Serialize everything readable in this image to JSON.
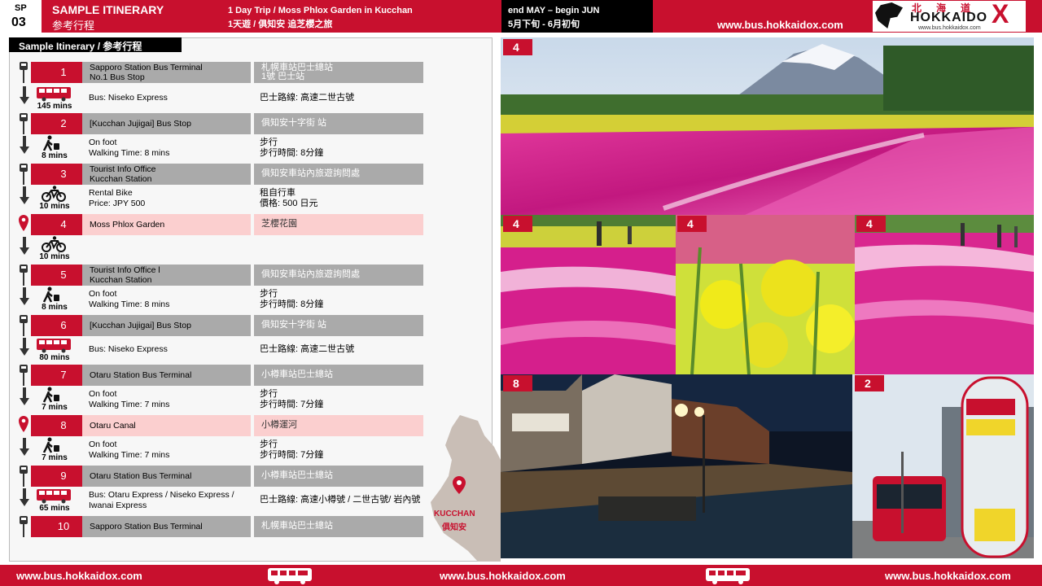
{
  "header": {
    "sp_label": "SP",
    "sp_number": "03",
    "title_en": "SAMPLE ITINERARY",
    "title_zh": "参考行程",
    "trip_en": "1 Day Trip / Moss Phlox Garden in Kucchan",
    "trip_zh": "1天遊 / 俱知安 追芝櫻之旅",
    "season_en": "end MAY – begin JUN",
    "season_zh": "5月下旬 - 6月初旬",
    "url": "www.bus.hokkaidox.com",
    "logo_kanji": "北海道",
    "logo_name": "HOKKAIDO",
    "logo_x": "X",
    "logo_url": "www.bus.hokkaidox.com"
  },
  "panel_title": "Sample Itinerary / 参考行程",
  "stops": [
    {
      "num": "1",
      "en": "Sapporo Station Bus Terminal\nNo.1 Bus Stop",
      "zh": "札幌車站巴士總站\n1號 巴士站",
      "type": "bus_stop",
      "highlight": false
    },
    {
      "num": "2",
      "en": "[Kucchan Jujigai] Bus Stop",
      "zh": "俱知安十字街 站",
      "type": "bus_stop",
      "highlight": false
    },
    {
      "num": "3",
      "en": "Tourist Info Office\nKucchan Station",
      "zh": "俱知安車站內旅遊詢問處",
      "type": "bus_stop",
      "highlight": false
    },
    {
      "num": "4",
      "en": "Moss Phlox Garden",
      "zh": "芝櫻花園",
      "type": "pin",
      "highlight": true
    },
    {
      "num": "5",
      "en": "Tourist Info Office l\nKucchan Station",
      "zh": "俱知安車站內旅遊詢問處",
      "type": "bus_stop",
      "highlight": false
    },
    {
      "num": "6",
      "en": "[Kucchan Jujigai] Bus Stop",
      "zh": "俱知安十字街 站",
      "type": "bus_stop",
      "highlight": false
    },
    {
      "num": "7",
      "en": "Otaru Station Bus Terminal",
      "zh": "小樽車站巴士總站",
      "type": "bus_stop",
      "highlight": false
    },
    {
      "num": "8",
      "en": "Otaru Canal",
      "zh": "小樽運河",
      "type": "pin",
      "highlight": true
    },
    {
      "num": "9",
      "en": "Otaru Station Bus Terminal",
      "zh": "小樽車站巴士總站",
      "type": "bus_stop",
      "highlight": false
    },
    {
      "num": "10",
      "en": "Sapporo Station Bus Terminal",
      "zh": "札幌車站巴士總站",
      "type": "bus_stop",
      "highlight": false
    }
  ],
  "transits": [
    {
      "mode": "bus",
      "mins": "145 mins",
      "en": "Bus: Niseko Express",
      "zh": "巴士路線: 高速二世古號"
    },
    {
      "mode": "walk",
      "mins": "8 mins",
      "en": "On foot\nWalking Time:  8 mins",
      "zh": "步行\n步行時間: 8分鐘"
    },
    {
      "mode": "bike",
      "mins": "10 mins",
      "en": "Rental Bike\nPrice: JPY  500",
      "zh": "租自行車\n價格: 500 日元"
    },
    {
      "mode": "bike",
      "mins": "10 mins",
      "en": "",
      "zh": ""
    },
    {
      "mode": "walk",
      "mins": "8 mins",
      "en": "On foot\nWalking Time:  8 mins",
      "zh": "步行\n步行時間: 8分鐘"
    },
    {
      "mode": "bus",
      "mins": "80 mins",
      "en": "Bus: Niseko Express",
      "zh": "巴士路線: 高速二世古號"
    },
    {
      "mode": "walk",
      "mins": "7 mins",
      "en": "On foot\nWalking Time:  7 mins",
      "zh": "步行\n步行時間: 7分鐘"
    },
    {
      "mode": "walk",
      "mins": "7 mins",
      "en": "On foot\nWalking Time:  7 mins",
      "zh": "步行\n步行時間: 7分鐘"
    },
    {
      "mode": "bus",
      "mins": "65 mins",
      "en": "Bus: Otaru Express / Niseko Express /\n        Iwanai Express",
      "zh": "巴士路線: 高速小樽號 / 二世古號/ 岩內號"
    }
  ],
  "map": {
    "label_en": "KUCCHAN",
    "label_zh": "俱知安"
  },
  "photos": [
    {
      "tag": "4",
      "subject": "moss-phlox-field-mountain"
    },
    {
      "tag": "4",
      "subject": "moss-phlox-field-people"
    },
    {
      "tag": "4",
      "subject": "rapeseed-flowers"
    },
    {
      "tag": "4",
      "subject": "moss-phlox-hill"
    },
    {
      "tag": "8",
      "subject": "otaru-canal-night"
    },
    {
      "tag": "2",
      "subject": "kucchan-jujigai-bus-stop"
    }
  ],
  "footer": {
    "url1": "www.bus.hokkaidox.com",
    "url2": "www.bus.hokkaidox.com",
    "url3": "www.bus.hokkaidox.com"
  },
  "colors": {
    "brand_red": "#c8102e",
    "bar_gray": "#aaaaaa",
    "highlight_pink": "#fbcfcf"
  }
}
